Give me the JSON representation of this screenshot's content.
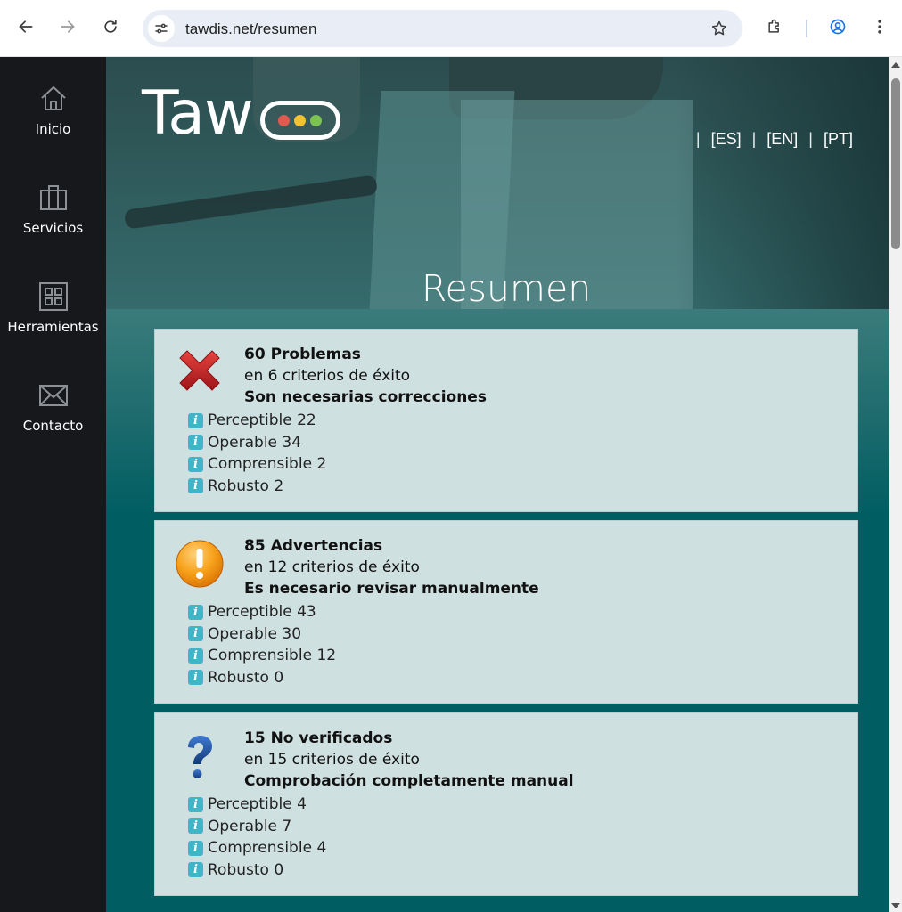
{
  "browser": {
    "url": "tawdis.net/resumen",
    "icons": [
      "back-arrow-icon",
      "forward-arrow-icon",
      "reload-icon",
      "site-info-icon",
      "star-icon",
      "extensions-icon",
      "profile-icon",
      "more-vert-icon"
    ]
  },
  "sidebar": {
    "items": [
      {
        "label": "Inicio",
        "icon": "home-icon"
      },
      {
        "label": "Servicios",
        "icon": "briefcase-icon"
      },
      {
        "label": "Herramientas",
        "icon": "grid-icon"
      },
      {
        "label": "Contacto",
        "icon": "envelope-icon"
      }
    ]
  },
  "header": {
    "logo_text": "Taw",
    "logo_lights": [
      "#e05a4f",
      "#f2c230",
      "#7cc451"
    ],
    "languages": [
      "[ES]",
      "[EN]",
      "[PT]"
    ],
    "separator": "|",
    "title": "Resumen"
  },
  "cards": [
    {
      "icon": "error-x-icon",
      "title": "60 Problemas",
      "subtitle": "en 6 criterios de éxito",
      "note": "Son necesarias correcciones",
      "items": [
        {
          "label": "Perceptible",
          "count": "22"
        },
        {
          "label": "Operable",
          "count": "34"
        },
        {
          "label": "Comprensible",
          "count": "2"
        },
        {
          "label": "Robusto",
          "count": "2"
        }
      ]
    },
    {
      "icon": "warning-exclamation-icon",
      "title": "85 Advertencias",
      "subtitle": "en 12 criterios de éxito",
      "note": "Es necesario revisar manualmente",
      "items": [
        {
          "label": "Perceptible",
          "count": "43"
        },
        {
          "label": "Operable",
          "count": "30"
        },
        {
          "label": "Comprensible",
          "count": "12"
        },
        {
          "label": "Robusto",
          "count": "0"
        }
      ]
    },
    {
      "icon": "question-mark-icon",
      "title": "15 No verificados",
      "subtitle": "en 15 criterios de éxito",
      "note": "Comprobación completamente manual",
      "items": [
        {
          "label": "Perceptible",
          "count": "4"
        },
        {
          "label": "Operable",
          "count": "7"
        },
        {
          "label": "Comprensible",
          "count": "4"
        },
        {
          "label": "Robusto",
          "count": "0"
        }
      ]
    }
  ],
  "info_glyph": "i",
  "colors": {
    "sidebar_bg": "#16181c",
    "main_bg": "#005e62",
    "card_bg": "#cfe0e0",
    "info_badge": "#3fb6c8",
    "error_red": "#c0262c",
    "warning_orange": "#f39c12",
    "question_blue": "#1e4e9a"
  }
}
